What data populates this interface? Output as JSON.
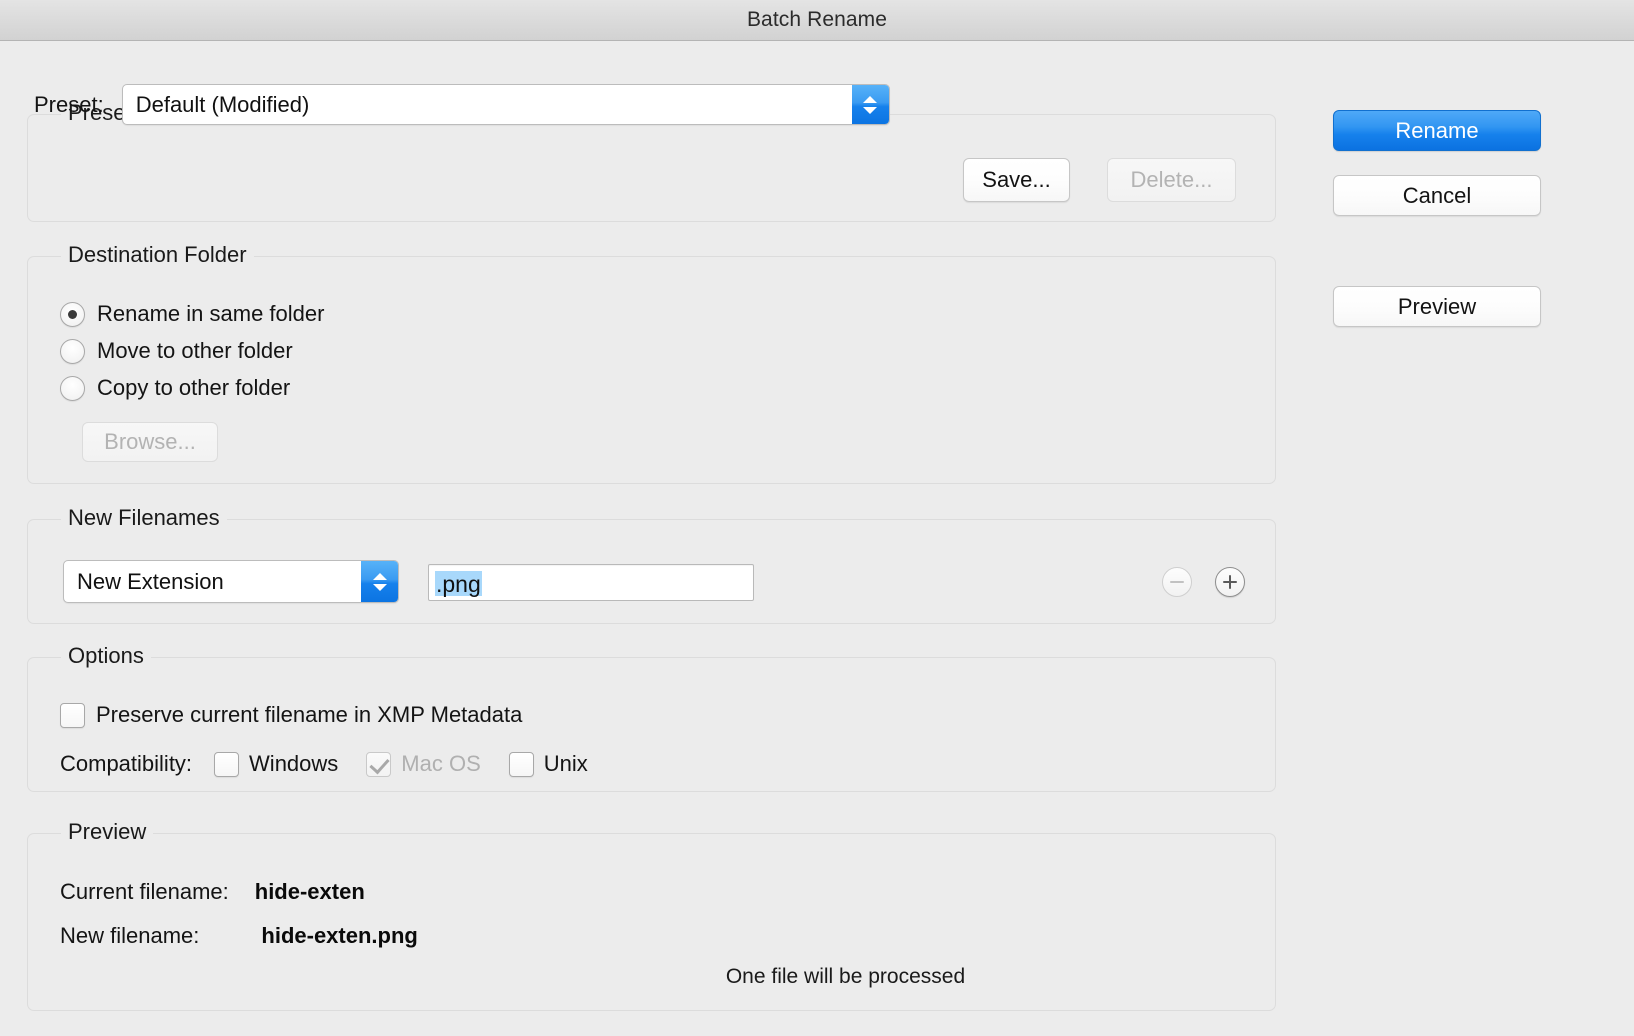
{
  "window": {
    "title": "Batch Rename"
  },
  "presets": {
    "group_title": "Presets",
    "preset_label": "Preset:",
    "preset_value": "Default (Modified)",
    "save_label": "Save...",
    "delete_label": "Delete..."
  },
  "destination": {
    "group_title": "Destination Folder",
    "options": [
      {
        "label": "Rename in same folder",
        "selected": true
      },
      {
        "label": "Move to other folder",
        "selected": false
      },
      {
        "label": "Copy to other folder",
        "selected": false
      }
    ],
    "browse_label": "Browse..."
  },
  "new_filenames": {
    "group_title": "New Filenames",
    "rule_type": "New Extension",
    "rule_value": ".png",
    "remove_icon": "minus-circle-icon",
    "add_icon": "plus-circle-icon"
  },
  "options": {
    "group_title": "Options",
    "preserve_label": "Preserve current filename in XMP Metadata",
    "preserve_checked": false,
    "compatibility_label": "Compatibility:",
    "compatibility": [
      {
        "label": "Windows",
        "checked": false,
        "disabled": false
      },
      {
        "label": "Mac OS",
        "checked": true,
        "disabled": true
      },
      {
        "label": "Unix",
        "checked": false,
        "disabled": false
      }
    ]
  },
  "preview": {
    "group_title": "Preview",
    "current_label": "Current filename:",
    "current_value": "hide-exten",
    "new_label": "New filename:",
    "new_value": "hide-exten.png",
    "count_text": "One file will be processed"
  },
  "actions": {
    "rename_label": "Rename",
    "cancel_label": "Cancel",
    "preview_label": "Preview"
  },
  "colors": {
    "accent": "#1681ec",
    "selection": "#a8d8fb",
    "background": "#ececec"
  }
}
